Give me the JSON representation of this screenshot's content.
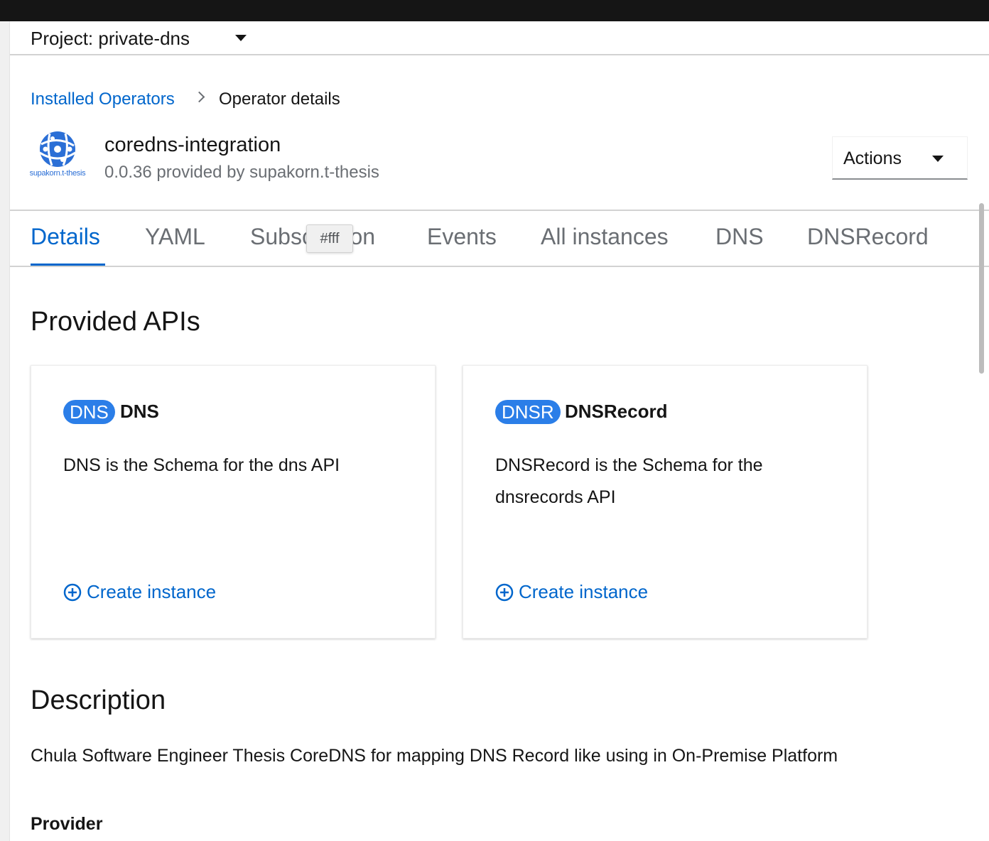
{
  "project": {
    "label": "Project: private-dns"
  },
  "breadcrumb": {
    "parent": "Installed Operators",
    "current": "Operator details"
  },
  "operator": {
    "logo_text": "supakorn.t-thesis",
    "name": "coredns-integration",
    "subtitle": "0.0.36 provided by supakorn.t-thesis"
  },
  "actions": {
    "label": "Actions"
  },
  "tabs": [
    {
      "label": "Details",
      "active": true
    },
    {
      "label": "YAML"
    },
    {
      "label": "Subscription"
    },
    {
      "label": "Events"
    },
    {
      "label": "All instances"
    },
    {
      "label": "DNS"
    },
    {
      "label": "DNSRecord"
    }
  ],
  "tooltip": {
    "text": "#fff"
  },
  "provided_apis": {
    "heading": "Provided APIs",
    "cards": [
      {
        "badge": "DNS",
        "title": "DNS",
        "description": "DNS is the Schema for the dns API",
        "action": "Create instance"
      },
      {
        "badge": "DNSR",
        "title": "DNSRecord",
        "description": "DNSRecord is the Schema for the dnsrecords API",
        "action": "Create instance"
      }
    ]
  },
  "description": {
    "heading": "Description",
    "text": "Chula Software Engineer Thesis CoreDNS for mapping DNS Record like using in On-Premise Platform"
  },
  "provider": {
    "heading": "Provider"
  },
  "colors": {
    "link": "#0066cc",
    "badge": "#2b7ee8",
    "text": "#151515",
    "muted": "#6a6e73"
  }
}
